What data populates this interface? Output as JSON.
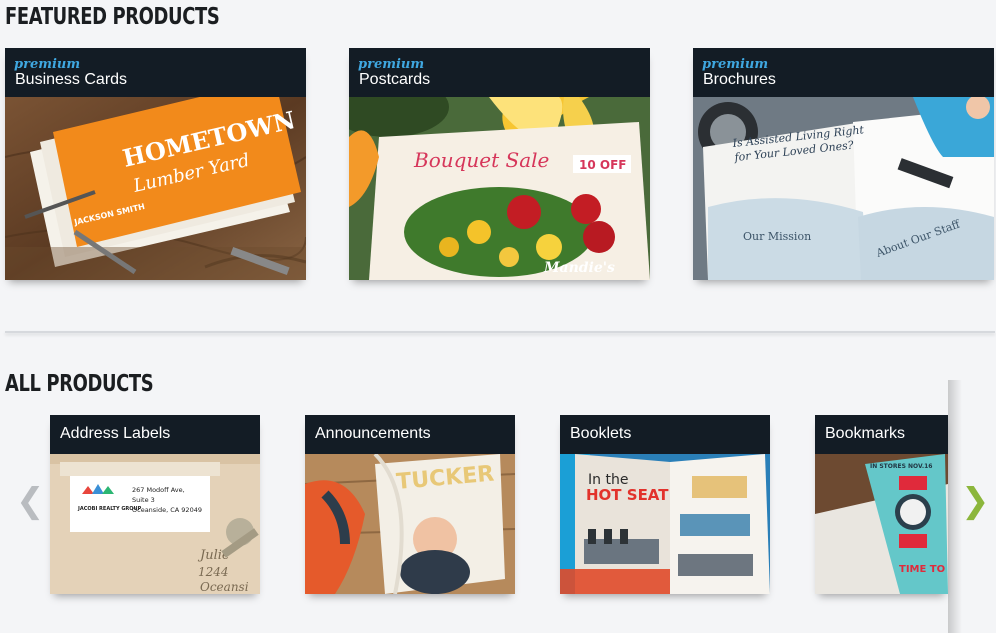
{
  "featured": {
    "title": "FEATURED PRODUCTS",
    "items": [
      {
        "badge": "premium",
        "label": "Business Cards",
        "img_text_1": "HOMETOWN",
        "img_text_2": "Lumber Yard",
        "img_text_3": "JACKSON SMITH"
      },
      {
        "badge": "premium",
        "label": "Postcards",
        "img_text_1": "Bouquet Sale",
        "img_text_2": "10 OFF",
        "img_text_3": "Mandie's"
      },
      {
        "badge": "premium",
        "label": "Brochures",
        "img_text_1": "Is Assisted Living Right",
        "img_text_2": "for Your Loved Ones?",
        "img_text_3": "Our Mission",
        "img_text_4": "About Our Staff"
      }
    ]
  },
  "all": {
    "title": "ALL PRODUCTS",
    "items": [
      {
        "label": "Address Labels",
        "img_text_1": "JACOBI REALTY GROUP",
        "img_text_2": "267 Modoff Ave,",
        "img_text_3": "Suite 3",
        "img_text_4": "Oceanside, CA 92049"
      },
      {
        "label": "Announcements",
        "img_text_1": "TUCKER"
      },
      {
        "label": "Booklets",
        "img_text_1": "In the",
        "img_text_2": "HOT SEAT"
      },
      {
        "label": "Bookmarks",
        "img_text_1": "IN STORES NOV.16",
        "img_text_2": "TIME TO KILL"
      }
    ],
    "prev_icon": "chevron-left-icon",
    "next_icon": "chevron-right-icon",
    "prev_glyph": "❮",
    "next_glyph": "❯"
  },
  "colors": {
    "header_bg": "#131c25",
    "premium": "#3fa7e0",
    "next_arrow": "#8cb63c"
  }
}
